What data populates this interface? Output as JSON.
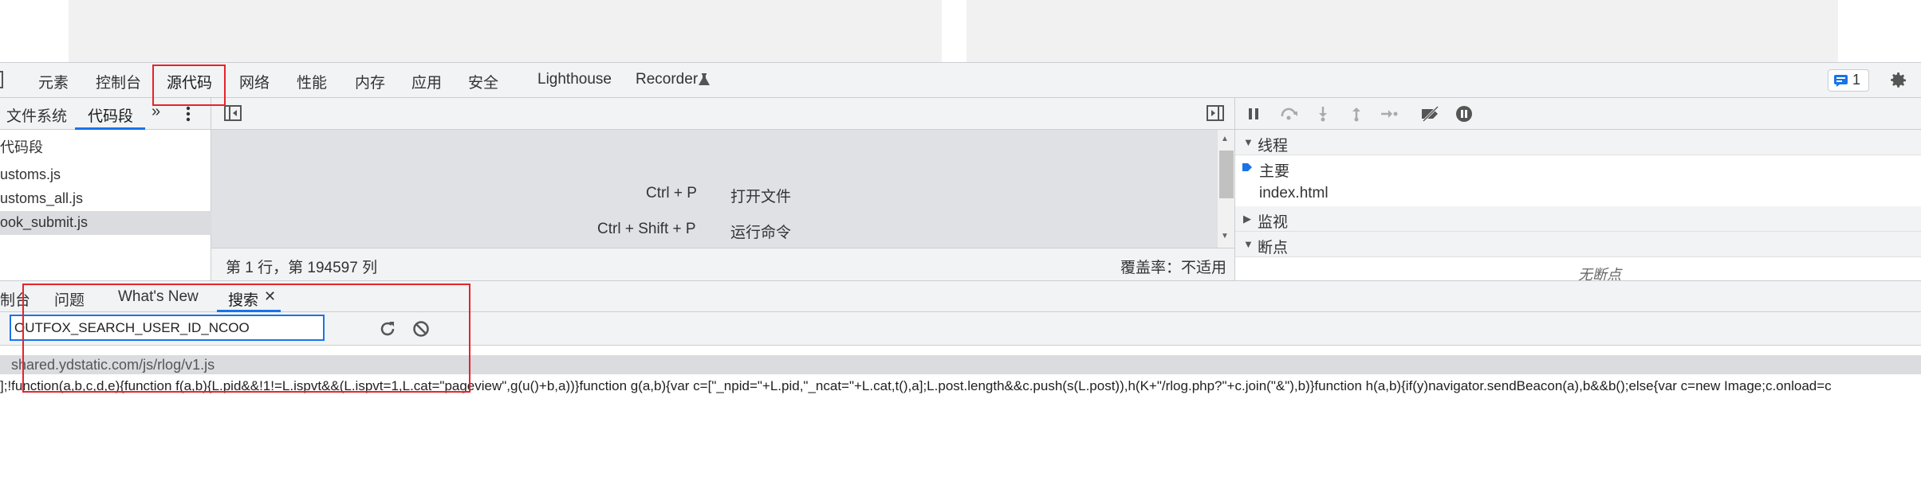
{
  "devtools": {
    "main_tabs": [
      "元素",
      "控制台",
      "源代码",
      "网络",
      "性能",
      "内存",
      "应用",
      "安全",
      "Lighthouse",
      "Recorder"
    ],
    "issues_badge": "1",
    "navigator": {
      "tabs": [
        "文件系统",
        "代码段"
      ],
      "header": "代码段",
      "items": [
        "ustoms.js",
        "ustoms_all.js",
        "ook_submit.js"
      ]
    },
    "editor": {
      "shortcuts": [
        {
          "keys": "Ctrl + P",
          "label": "打开文件"
        },
        {
          "keys": "Ctrl + Shift + P",
          "label": "运行命令"
        }
      ],
      "status_position": "第 1 行，第 194597 列",
      "status_coverage": "覆盖率：不适用"
    },
    "debugger": {
      "threads_title": "线程",
      "thread_main": "主要",
      "thread_index": "index.html",
      "watch_title": "监视",
      "breakpoints_title": "断点",
      "no_breakpoints": "无断点"
    },
    "drawer": {
      "tabs": [
        "制台",
        "问题",
        "What's New",
        "搜索"
      ],
      "search_value": "OUTFOX_SEARCH_USER_ID_NCOO",
      "result_file": "shared.ydstatic.com/js/rlog/v1.js",
      "result_line": "];!function(a,b,c,d,e){function f(a,b){L.pid&&!1!=L.ispvt&&(L.ispvt=1,L.cat=\"pageview\",g(u()+b,a))}function g(a,b){var c=[\"_npid=\"+L.pid,\"_ncat=\"+L.cat,t(),a];L.post.length&&c.push(s(L.post)),h(K+\"/rlog.php?\"+c.join(\"&\"),b)}function h(a,b){if(y)navigator.sendBeacon(a),b&&b();else{var c=new Image;c.onload=c"
    }
  },
  "colors": {
    "highlight": "#e8232a",
    "accent": "#1a73e8"
  }
}
